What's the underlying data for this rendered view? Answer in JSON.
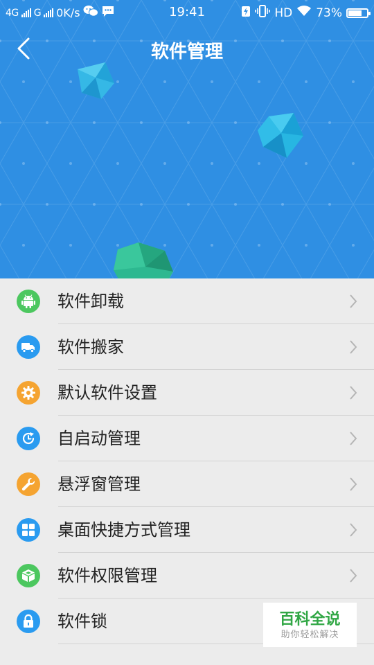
{
  "status_bar": {
    "sim1": "4G",
    "sim2": "G",
    "speed": "0K/s",
    "time": "19:41",
    "hd": "HD",
    "battery_percent_text": "73%",
    "battery_level": 0.73
  },
  "header": {
    "title": "软件管理"
  },
  "menu": [
    {
      "label": "软件卸载",
      "icon": "android-icon",
      "color": "#4cc75f"
    },
    {
      "label": "软件搬家",
      "icon": "truck-icon",
      "color": "#2a9bf0"
    },
    {
      "label": "默认软件设置",
      "icon": "gear-icon",
      "color": "#f5a431"
    },
    {
      "label": "自启动管理",
      "icon": "clock-icon",
      "color": "#2a9bf0"
    },
    {
      "label": "悬浮窗管理",
      "icon": "wrench-icon",
      "color": "#f5a431"
    },
    {
      "label": "桌面快捷方式管理",
      "icon": "grid-icon",
      "color": "#2a9bf0"
    },
    {
      "label": "软件权限管理",
      "icon": "cube-icon",
      "color": "#4cc75f"
    },
    {
      "label": "软件锁",
      "icon": "lock-icon",
      "color": "#2a9bf0"
    }
  ],
  "watermark": {
    "title": "百科全说",
    "subtitle": "助你轻松解决"
  }
}
